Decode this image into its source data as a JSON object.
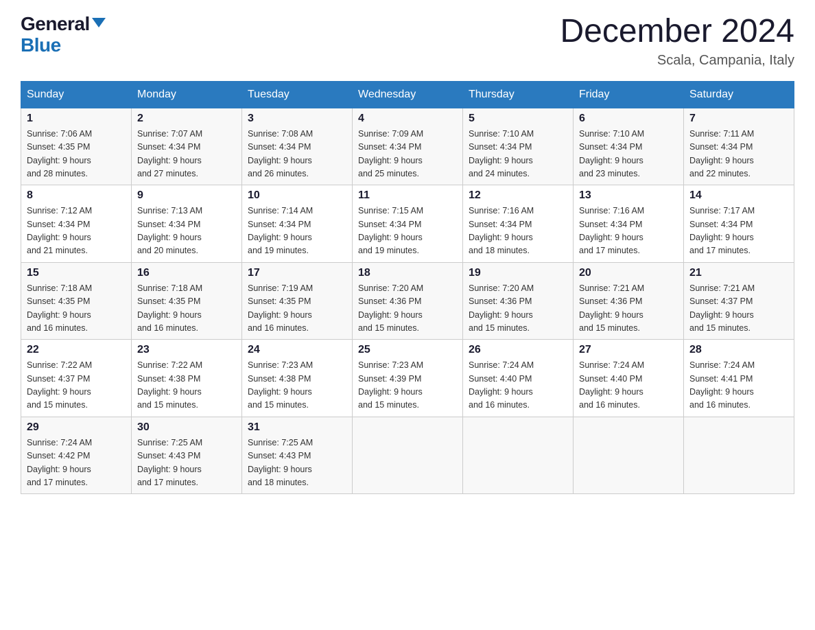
{
  "logo": {
    "general": "General",
    "blue": "Blue"
  },
  "title": "December 2024",
  "location": "Scala, Campania, Italy",
  "days_of_week": [
    "Sunday",
    "Monday",
    "Tuesday",
    "Wednesday",
    "Thursday",
    "Friday",
    "Saturday"
  ],
  "weeks": [
    [
      {
        "day": "1",
        "sunrise": "7:06 AM",
        "sunset": "4:35 PM",
        "daylight": "9 hours and 28 minutes."
      },
      {
        "day": "2",
        "sunrise": "7:07 AM",
        "sunset": "4:34 PM",
        "daylight": "9 hours and 27 minutes."
      },
      {
        "day": "3",
        "sunrise": "7:08 AM",
        "sunset": "4:34 PM",
        "daylight": "9 hours and 26 minutes."
      },
      {
        "day": "4",
        "sunrise": "7:09 AM",
        "sunset": "4:34 PM",
        "daylight": "9 hours and 25 minutes."
      },
      {
        "day": "5",
        "sunrise": "7:10 AM",
        "sunset": "4:34 PM",
        "daylight": "9 hours and 24 minutes."
      },
      {
        "day": "6",
        "sunrise": "7:10 AM",
        "sunset": "4:34 PM",
        "daylight": "9 hours and 23 minutes."
      },
      {
        "day": "7",
        "sunrise": "7:11 AM",
        "sunset": "4:34 PM",
        "daylight": "9 hours and 22 minutes."
      }
    ],
    [
      {
        "day": "8",
        "sunrise": "7:12 AM",
        "sunset": "4:34 PM",
        "daylight": "9 hours and 21 minutes."
      },
      {
        "day": "9",
        "sunrise": "7:13 AM",
        "sunset": "4:34 PM",
        "daylight": "9 hours and 20 minutes."
      },
      {
        "day": "10",
        "sunrise": "7:14 AM",
        "sunset": "4:34 PM",
        "daylight": "9 hours and 19 minutes."
      },
      {
        "day": "11",
        "sunrise": "7:15 AM",
        "sunset": "4:34 PM",
        "daylight": "9 hours and 19 minutes."
      },
      {
        "day": "12",
        "sunrise": "7:16 AM",
        "sunset": "4:34 PM",
        "daylight": "9 hours and 18 minutes."
      },
      {
        "day": "13",
        "sunrise": "7:16 AM",
        "sunset": "4:34 PM",
        "daylight": "9 hours and 17 minutes."
      },
      {
        "day": "14",
        "sunrise": "7:17 AM",
        "sunset": "4:34 PM",
        "daylight": "9 hours and 17 minutes."
      }
    ],
    [
      {
        "day": "15",
        "sunrise": "7:18 AM",
        "sunset": "4:35 PM",
        "daylight": "9 hours and 16 minutes."
      },
      {
        "day": "16",
        "sunrise": "7:18 AM",
        "sunset": "4:35 PM",
        "daylight": "9 hours and 16 minutes."
      },
      {
        "day": "17",
        "sunrise": "7:19 AM",
        "sunset": "4:35 PM",
        "daylight": "9 hours and 16 minutes."
      },
      {
        "day": "18",
        "sunrise": "7:20 AM",
        "sunset": "4:36 PM",
        "daylight": "9 hours and 15 minutes."
      },
      {
        "day": "19",
        "sunrise": "7:20 AM",
        "sunset": "4:36 PM",
        "daylight": "9 hours and 15 minutes."
      },
      {
        "day": "20",
        "sunrise": "7:21 AM",
        "sunset": "4:36 PM",
        "daylight": "9 hours and 15 minutes."
      },
      {
        "day": "21",
        "sunrise": "7:21 AM",
        "sunset": "4:37 PM",
        "daylight": "9 hours and 15 minutes."
      }
    ],
    [
      {
        "day": "22",
        "sunrise": "7:22 AM",
        "sunset": "4:37 PM",
        "daylight": "9 hours and 15 minutes."
      },
      {
        "day": "23",
        "sunrise": "7:22 AM",
        "sunset": "4:38 PM",
        "daylight": "9 hours and 15 minutes."
      },
      {
        "day": "24",
        "sunrise": "7:23 AM",
        "sunset": "4:38 PM",
        "daylight": "9 hours and 15 minutes."
      },
      {
        "day": "25",
        "sunrise": "7:23 AM",
        "sunset": "4:39 PM",
        "daylight": "9 hours and 15 minutes."
      },
      {
        "day": "26",
        "sunrise": "7:24 AM",
        "sunset": "4:40 PM",
        "daylight": "9 hours and 16 minutes."
      },
      {
        "day": "27",
        "sunrise": "7:24 AM",
        "sunset": "4:40 PM",
        "daylight": "9 hours and 16 minutes."
      },
      {
        "day": "28",
        "sunrise": "7:24 AM",
        "sunset": "4:41 PM",
        "daylight": "9 hours and 16 minutes."
      }
    ],
    [
      {
        "day": "29",
        "sunrise": "7:24 AM",
        "sunset": "4:42 PM",
        "daylight": "9 hours and 17 minutes."
      },
      {
        "day": "30",
        "sunrise": "7:25 AM",
        "sunset": "4:43 PM",
        "daylight": "9 hours and 17 minutes."
      },
      {
        "day": "31",
        "sunrise": "7:25 AM",
        "sunset": "4:43 PM",
        "daylight": "9 hours and 18 minutes."
      },
      null,
      null,
      null,
      null
    ]
  ],
  "labels": {
    "sunrise": "Sunrise:",
    "sunset": "Sunset:",
    "daylight": "Daylight:"
  }
}
